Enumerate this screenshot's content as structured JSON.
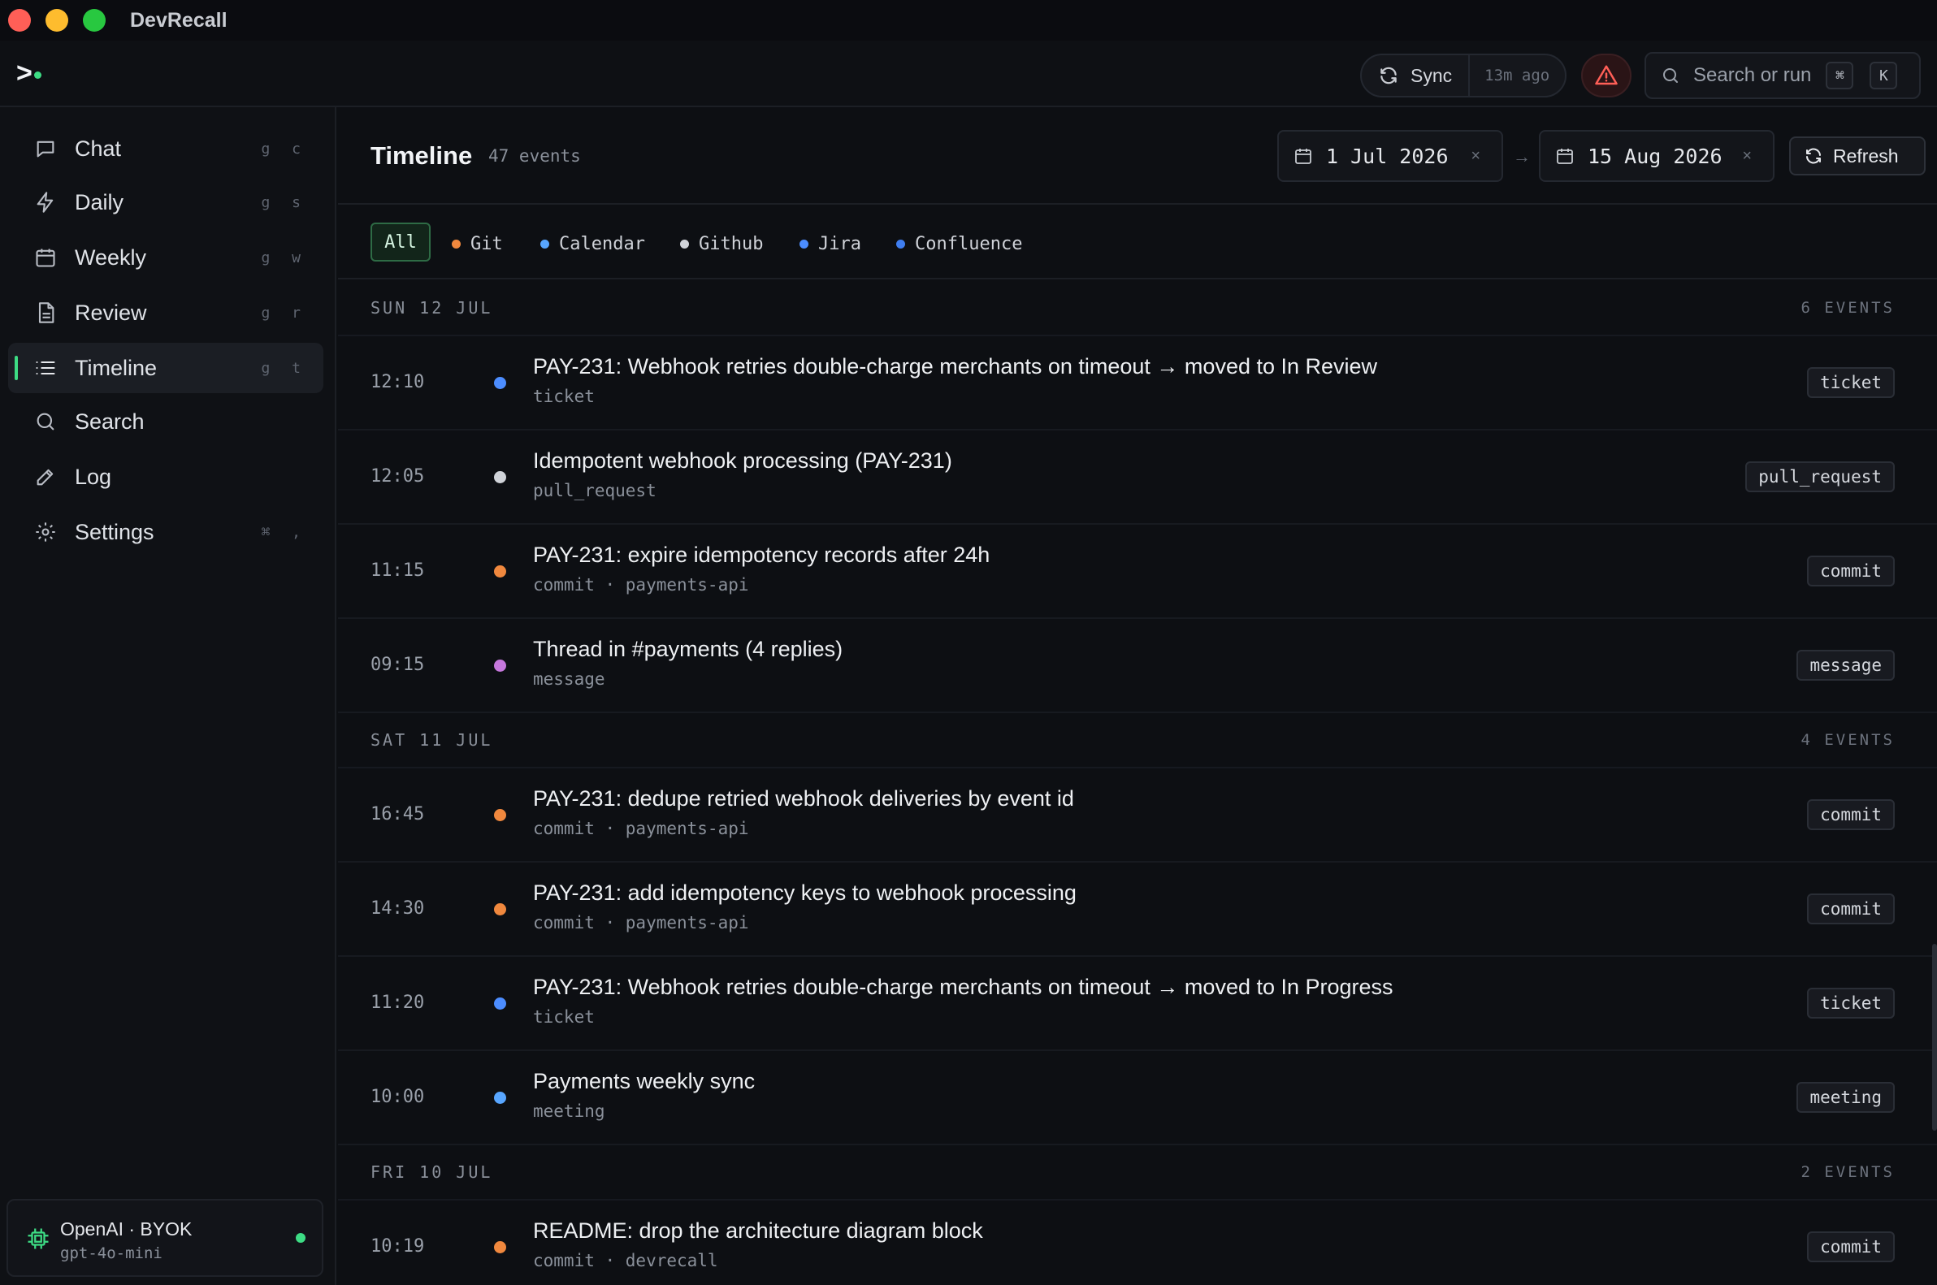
{
  "app": {
    "title": "DevRecall"
  },
  "header": {
    "logo_icon": "terminal-prompt-icon",
    "sync_label": "Sync",
    "sync_time": "13m ago",
    "search_placeholder": "Search or run",
    "search_kbd_1": "⌘",
    "search_kbd_2": "K",
    "alert_color": "#ff5f57"
  },
  "sidebar": {
    "items": [
      {
        "label": "Chat",
        "shortcut": "g c",
        "icon": "chat-bubble-icon",
        "active": false
      },
      {
        "label": "Daily",
        "shortcut": "g s",
        "icon": "lightning-icon",
        "active": false
      },
      {
        "label": "Weekly",
        "shortcut": "g w",
        "icon": "calendar-icon",
        "active": false
      },
      {
        "label": "Review",
        "shortcut": "g r",
        "icon": "document-icon",
        "active": false
      },
      {
        "label": "Timeline",
        "shortcut": "g t",
        "icon": "list-icon",
        "active": true
      },
      {
        "label": "Search",
        "shortcut": "",
        "icon": "search-icon",
        "active": false
      },
      {
        "label": "Log",
        "shortcut": "",
        "icon": "pencil-icon",
        "active": false
      },
      {
        "label": "Settings",
        "shortcut": "⌘ ,",
        "icon": "gear-icon",
        "active": false
      }
    ],
    "model": {
      "name": "OpenAI · BYOK",
      "id": "gpt-4o-mini",
      "icon": "chip-icon",
      "status_color": "#3ddc84"
    }
  },
  "main": {
    "title": "Timeline",
    "count": "47 events",
    "date_from": "1 Jul 2026",
    "date_to": "15 Aug 2026",
    "clear_glyph": "×",
    "arrow_glyph": "→",
    "refresh_label": "Refresh",
    "filters": {
      "all_label": "All",
      "sources": [
        {
          "label": "Git",
          "color": "#f0883e"
        },
        {
          "label": "Calendar",
          "color": "#58a6ff"
        },
        {
          "label": "Github",
          "color": "#d0d3d9"
        },
        {
          "label": "Jira",
          "color": "#4c8dff"
        },
        {
          "label": "Confluence",
          "color": "#3f7ef0"
        }
      ]
    },
    "groups": [
      {
        "date": "SUN 12 JUL",
        "count": "6 EVENTS",
        "events": [
          {
            "time": "12:10",
            "title": "PAY-231: Webhook retries double-charge merchants on timeout → moved to In Review",
            "sub": "ticket",
            "tag": "ticket",
            "color": "#4c8dff"
          },
          {
            "time": "12:05",
            "title": "Idempotent webhook processing (PAY-231)",
            "sub": "pull_request",
            "tag": "pull_request",
            "color": "#d0d3d9"
          },
          {
            "time": "11:15",
            "title": "PAY-231: expire idempotency records after 24h",
            "sub": "commit · payments-api",
            "tag": "commit",
            "color": "#f0883e"
          },
          {
            "time": "09:15",
            "title": "Thread in #payments (4 replies)",
            "sub": "message",
            "tag": "message",
            "color": "#c678dd"
          }
        ]
      },
      {
        "date": "SAT 11 JUL",
        "count": "4 EVENTS",
        "events": [
          {
            "time": "16:45",
            "title": "PAY-231: dedupe retried webhook deliveries by event id",
            "sub": "commit · payments-api",
            "tag": "commit",
            "color": "#f0883e"
          },
          {
            "time": "14:30",
            "title": "PAY-231: add idempotency keys to webhook processing",
            "sub": "commit · payments-api",
            "tag": "commit",
            "color": "#f0883e"
          },
          {
            "time": "11:20",
            "title": "PAY-231: Webhook retries double-charge merchants on timeout → moved to In Progress",
            "sub": "ticket",
            "tag": "ticket",
            "color": "#4c8dff"
          },
          {
            "time": "10:00",
            "title": "Payments weekly sync",
            "sub": "meeting",
            "tag": "meeting",
            "color": "#58a6ff"
          }
        ]
      },
      {
        "date": "FRI 10 JUL",
        "count": "2 EVENTS",
        "events": [
          {
            "time": "10:19",
            "title": "README: drop the architecture diagram block",
            "sub": "commit · devrecall",
            "tag": "commit",
            "color": "#f0883e"
          }
        ]
      }
    ]
  }
}
